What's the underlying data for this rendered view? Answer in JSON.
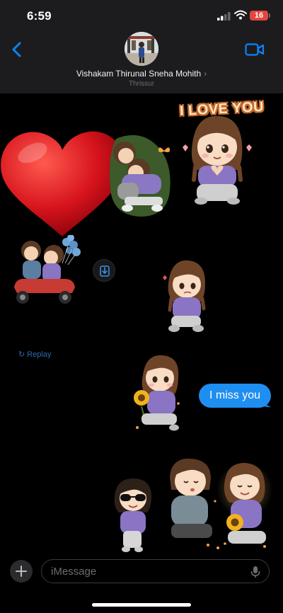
{
  "status_bar": {
    "time": "6:59",
    "battery": "16"
  },
  "header": {
    "contact_name": "Vishakam Thirunal Sneha Mohith",
    "contact_location": "Thrissur"
  },
  "stickers": {
    "love_text": "I LOVE YOU"
  },
  "chat": {
    "replay_label": "Replay",
    "sent_message": "I miss you"
  },
  "composer": {
    "placeholder": "iMessage"
  },
  "colors": {
    "accent": "#1f8ef1",
    "header_bg": "#1c1c1e",
    "battery": "#e2463f"
  }
}
